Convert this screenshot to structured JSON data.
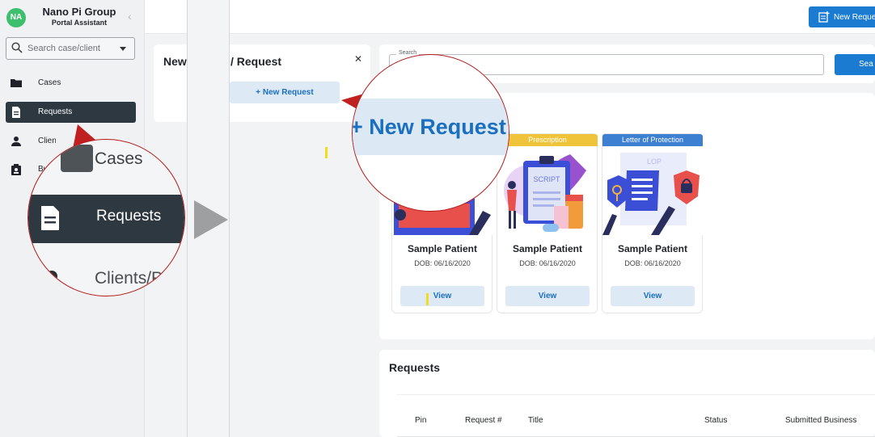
{
  "sidebar": {
    "avatar_initials": "NA",
    "brand_name": "Nano Pi Group",
    "brand_subtitle": "Portal Assistant",
    "search_placeholder": "Search case/client",
    "items": [
      {
        "label": "Cases",
        "icon": "folder-icon",
        "active": false
      },
      {
        "label": "Requests",
        "icon": "document-icon",
        "active": true
      },
      {
        "label": "Clients/Pat",
        "icon": "person-icon",
        "active": false
      },
      {
        "label": "Bu",
        "icon": "badge-icon",
        "active": false
      }
    ]
  },
  "topbar": {
    "new_request_label": "New Reques"
  },
  "new_request_panel": {
    "title_left": "New",
    "title_right": "/ Request",
    "add_button_label": "+ New Request"
  },
  "search": {
    "legend": "Search",
    "button_label": "Sea"
  },
  "cards": [
    {
      "tag": "",
      "tag_color": "#ffffff",
      "name": "Sample Patient",
      "dob": "DOB: 06/16/2020",
      "view_label": "View"
    },
    {
      "tag": "Prescription",
      "tag_color": "#f0c43a",
      "name": "Sample Patient",
      "dob": "DOB: 06/16/2020",
      "view_label": "View"
    },
    {
      "tag": "Letter of Protection",
      "tag_color": "#3d7fd0",
      "name": "Sample Patient",
      "dob": "DOB: 06/16/2020",
      "view_label": "View"
    }
  ],
  "requests": {
    "title": "Requests",
    "columns": [
      "Pin",
      "Request #",
      "Title",
      "Status",
      "Submitted Business"
    ]
  },
  "zoom_sidebar": {
    "cases": "Cases",
    "requests": "Requests",
    "clients": "Clients/P"
  },
  "zoom_button": {
    "text": "+ New Request"
  },
  "illustrations": {
    "script_label": "SCRIPT",
    "lop_label": "LOP"
  }
}
